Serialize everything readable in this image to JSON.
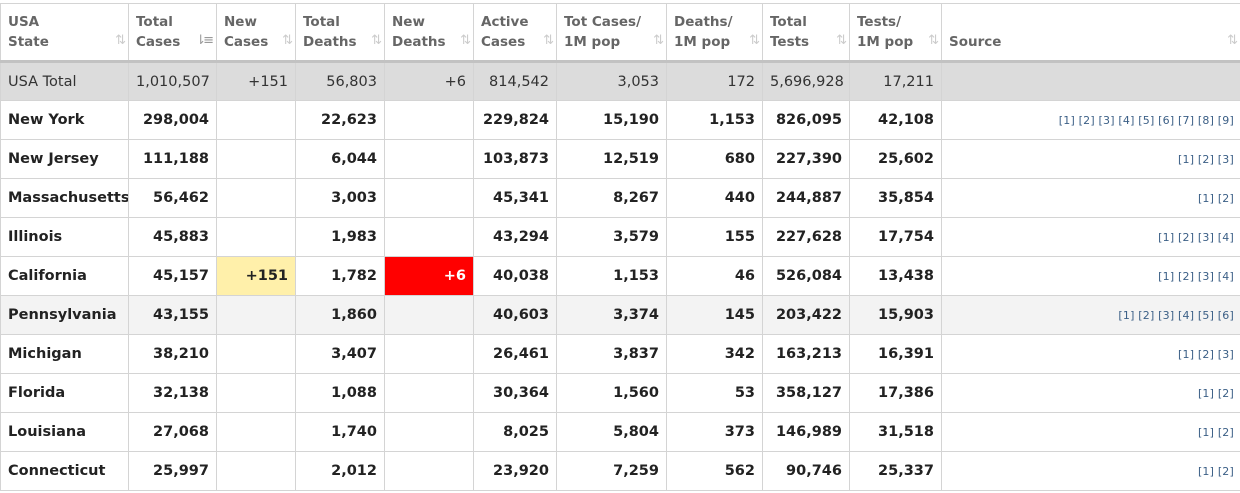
{
  "headers": [
    {
      "l1": "USA",
      "l2": "State"
    },
    {
      "l1": "Total",
      "l2": "Cases"
    },
    {
      "l1": "New",
      "l2": "Cases"
    },
    {
      "l1": "Total",
      "l2": "Deaths"
    },
    {
      "l1": "New",
      "l2": "Deaths"
    },
    {
      "l1": "Active",
      "l2": "Cases"
    },
    {
      "l1": "Tot Cases/",
      "l2": "1M pop"
    },
    {
      "l1": "Deaths/",
      "l2": "1M pop"
    },
    {
      "l1": "Total",
      "l2": "Tests"
    },
    {
      "l1": "Tests/",
      "l2": "1M pop"
    },
    {
      "l1": "",
      "l2": "Source"
    }
  ],
  "sort_icon": "⇅",
  "sort_active_icon": "⇂≡",
  "total": [
    "USA Total",
    "1,010,507",
    "+151",
    "56,803",
    "+6",
    "814,542",
    "3,053",
    "172",
    "5,696,928",
    "17,211",
    ""
  ],
  "rows": [
    [
      "New York",
      "298,004",
      "",
      "22,623",
      "",
      "229,824",
      "15,190",
      "1,153",
      "826,095",
      "42,108",
      "[1] [2] [3] [4] [5] [6] [7] [8] [9]"
    ],
    [
      "New Jersey",
      "111,188",
      "",
      "6,044",
      "",
      "103,873",
      "12,519",
      "680",
      "227,390",
      "25,602",
      "[1] [2] [3]"
    ],
    [
      "Massachusetts",
      "56,462",
      "",
      "3,003",
      "",
      "45,341",
      "8,267",
      "440",
      "244,887",
      "35,854",
      "[1] [2]"
    ],
    [
      "Illinois",
      "45,883",
      "",
      "1,983",
      "",
      "43,294",
      "3,579",
      "155",
      "227,628",
      "17,754",
      "[1] [2] [3] [4]"
    ],
    [
      "California",
      "45,157",
      "+151",
      "1,782",
      "+6",
      "40,038",
      "1,153",
      "46",
      "526,084",
      "13,438",
      "[1] [2] [3] [4]"
    ],
    [
      "Pennsylvania",
      "43,155",
      "",
      "1,860",
      "",
      "40,603",
      "3,374",
      "145",
      "203,422",
      "15,903",
      "[1] [2] [3] [4] [5] [6]"
    ],
    [
      "Michigan",
      "38,210",
      "",
      "3,407",
      "",
      "26,461",
      "3,837",
      "342",
      "163,213",
      "16,391",
      "[1] [2] [3]"
    ],
    [
      "Florida",
      "32,138",
      "",
      "1,088",
      "",
      "30,364",
      "1,560",
      "53",
      "358,127",
      "17,386",
      "[1] [2]"
    ],
    [
      "Louisiana",
      "27,068",
      "",
      "1,740",
      "",
      "8,025",
      "5,804",
      "373",
      "146,989",
      "31,518",
      "[1] [2]"
    ],
    [
      "Connecticut",
      "25,997",
      "",
      "2,012",
      "",
      "23,920",
      "7,259",
      "562",
      "90,746",
      "25,337",
      "[1] [2]"
    ]
  ],
  "colors": {
    "new_cases_highlight": "#fff0aa",
    "new_deaths_highlight": "#ff0000"
  }
}
